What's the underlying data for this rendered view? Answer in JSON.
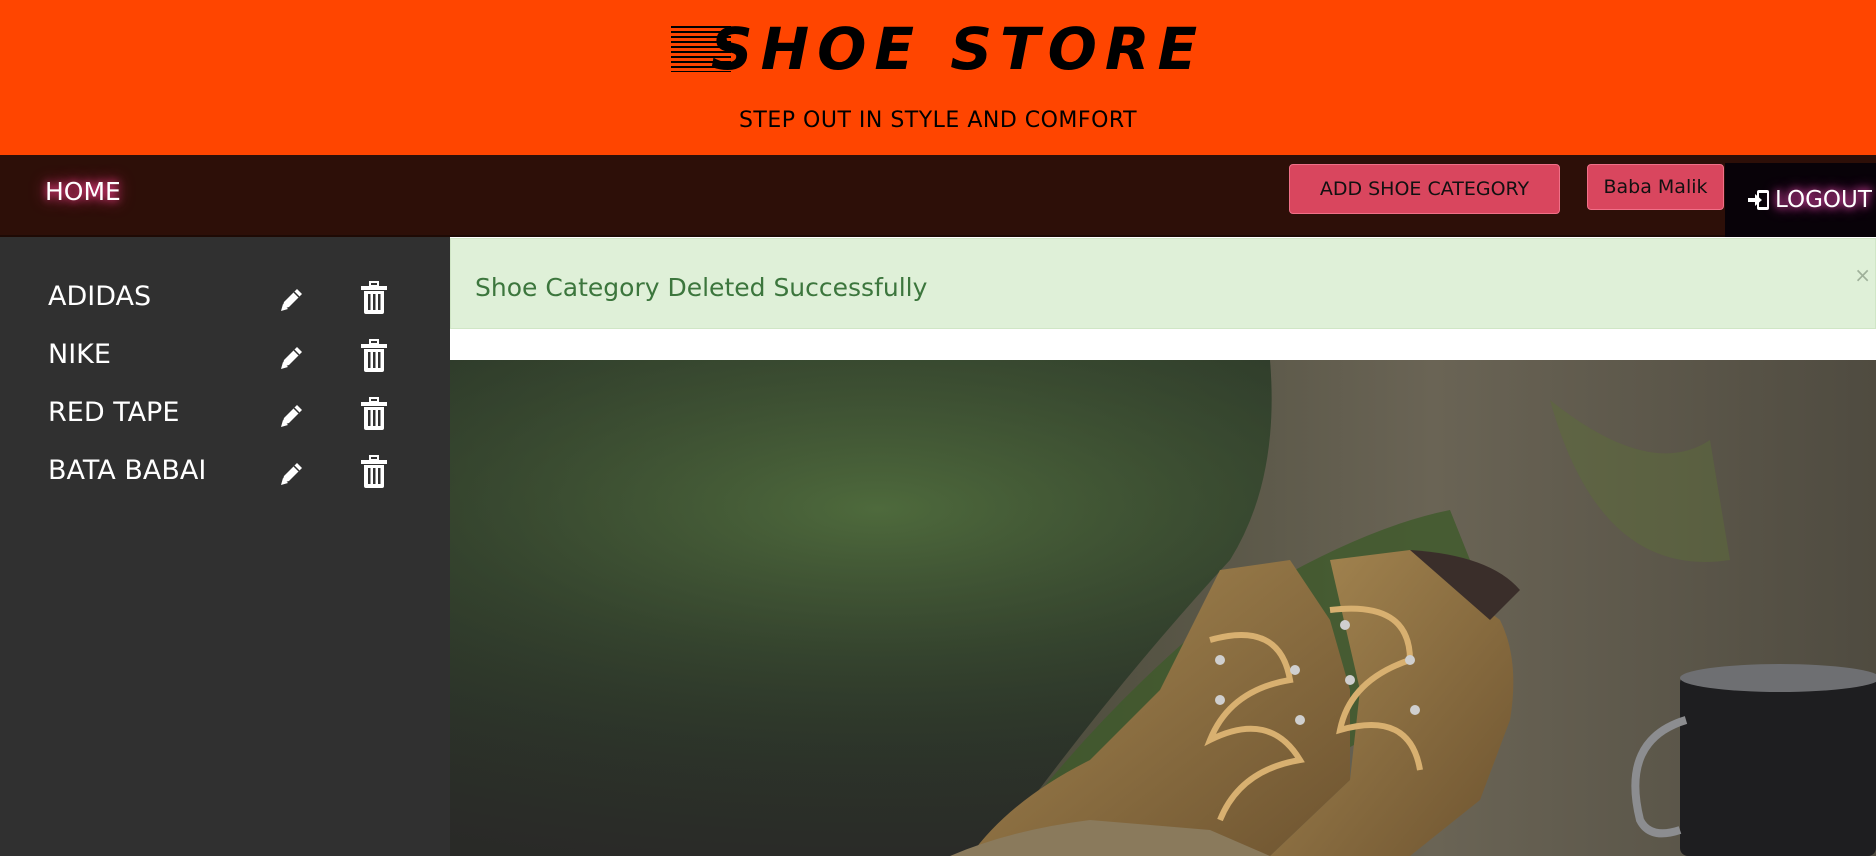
{
  "header": {
    "logo_text": "SHOE STORE",
    "tagline": "STEP OUT IN STYLE AND COMFORT",
    "background": "#ff4500"
  },
  "navbar": {
    "home_label": "HOME",
    "add_category_label": "ADD SHOE CATEGORY",
    "user_label": "Baba Malik",
    "logout_label": "LOGOUT",
    "background": "#2d0f08"
  },
  "sidebar": {
    "items": [
      {
        "label": "ADIDAS",
        "edit_icon": "pencil-icon",
        "delete_icon": "trash-icon"
      },
      {
        "label": "NIKE",
        "edit_icon": "pencil-icon",
        "delete_icon": "trash-icon"
      },
      {
        "label": "RED TAPE",
        "edit_icon": "pencil-icon",
        "delete_icon": "trash-icon"
      },
      {
        "label": "BATA BABAI",
        "edit_icon": "pencil-icon",
        "delete_icon": "trash-icon"
      }
    ]
  },
  "alert": {
    "message": "Shoe Category Deleted Successfully",
    "close_symbol": "×",
    "background": "#dff0d8",
    "text_color": "#3c763d"
  }
}
